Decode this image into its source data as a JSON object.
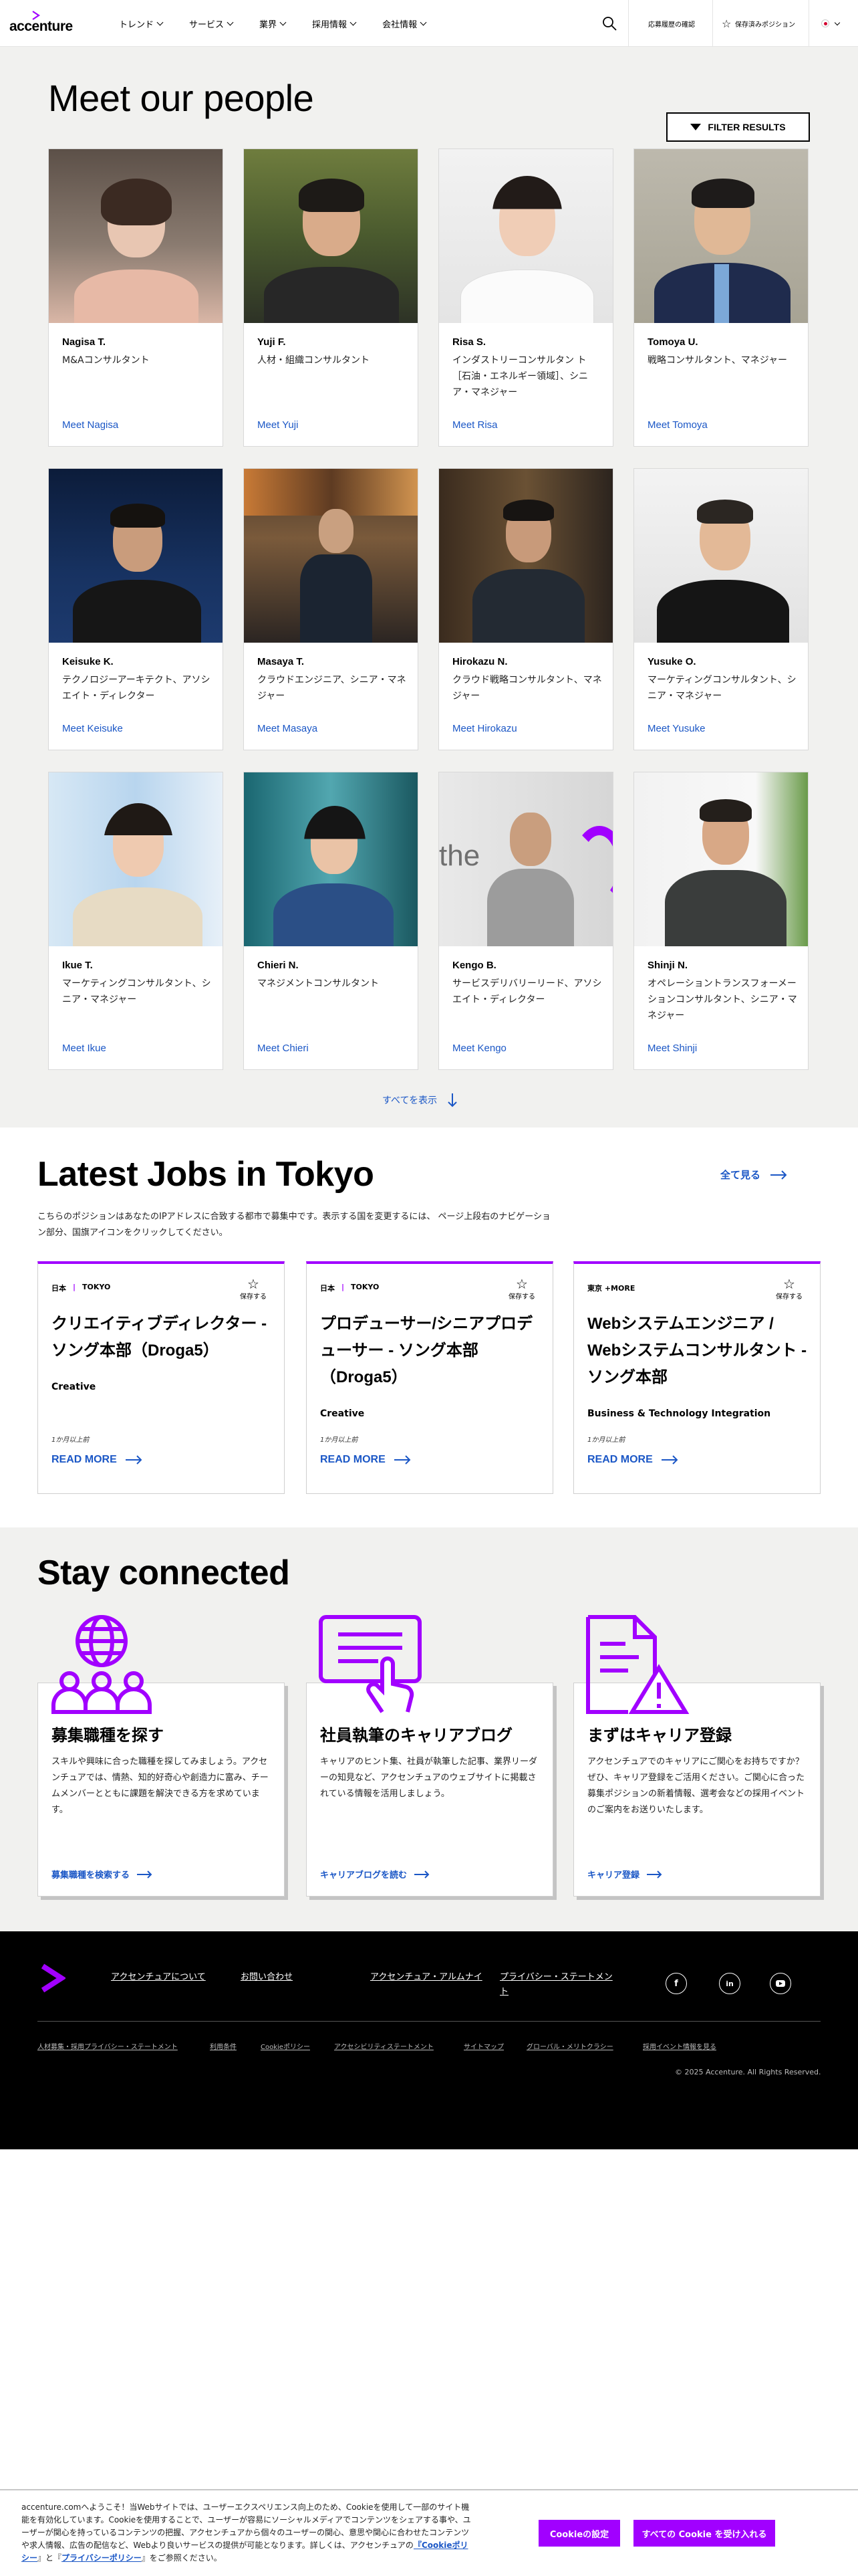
{
  "header": {
    "logo_text": "accenture",
    "nav": [
      {
        "label": "トレンド"
      },
      {
        "label": "サービス"
      },
      {
        "label": "業界"
      },
      {
        "label": "採用情報"
      },
      {
        "label": "会社情報"
      }
    ],
    "history_link": "応募履歴の確認",
    "saved_link": "保存済みポジション"
  },
  "people": {
    "title": "Meet our people",
    "filter_label": "FILTER RESULTS",
    "cards": [
      {
        "name": "Nagisa T.",
        "role": "M&Aコンサルタント",
        "link": "Meet Nagisa"
      },
      {
        "name": "Yuji F.",
        "role": "人材・組織コンサルタント",
        "link": "Meet Yuji"
      },
      {
        "name": "Risa S.",
        "role": "インダストリーコンサルタン ト［石油・エネルギー領域］、シニア・マネジャー",
        "link": "Meet Risa"
      },
      {
        "name": "Tomoya U.",
        "role": "戦略コンサルタント、マネジャー",
        "link": "Meet Tomoya"
      },
      {
        "name": "Keisuke K.",
        "role": "テクノロジーアーキテクト、アソシエイト・ディレクター",
        "link": "Meet Keisuke"
      },
      {
        "name": "Masaya T.",
        "role": "クラウドエンジニア、シニア・マネジャー",
        "link": "Meet Masaya"
      },
      {
        "name": "Hirokazu N.",
        "role": "クラウド戦略コンサルタント、マネジャー",
        "link": "Meet Hirokazu"
      },
      {
        "name": "Yusuke O.",
        "role": "マーケティングコンサルタント、シニア・マネジャー",
        "link": "Meet Yusuke"
      },
      {
        "name": "Ikue T.",
        "role": "マーケティングコンサルタント、シニア・マネジャー",
        "link": "Meet Ikue"
      },
      {
        "name": "Chieri N.",
        "role": "マネジメントコンサルタント",
        "link": "Meet Chieri"
      },
      {
        "name": "Kengo B.",
        "role": "サービスデリバリーリード、アソシエイト・ディレクター",
        "link": "Meet Kengo"
      },
      {
        "name": "Shinji N.",
        "role": "オペレーショントランスフォーメーションコンサルタント、シニア・マネジャー",
        "link": "Meet Shinji"
      }
    ],
    "show_all": "すべてを表示"
  },
  "jobs": {
    "title": "Latest Jobs in Tokyo",
    "see_all": "全て見る",
    "note": "こちらのポジションはあなたのIPアドレスに合致する都市で募集中です。表示する国を変更するには、 ページ上段右のナビゲーション部分、国旗アイコンをクリックしてください。",
    "save_label": "保存する",
    "more_label": "READ MORE",
    "cards": [
      {
        "country": "日本",
        "city": "TOKYO",
        "title": "クリエイティブディレクター - ソング本部（Droga5）",
        "category": "Creative",
        "posted": "1か月以上前"
      },
      {
        "country": "日本",
        "city": "TOKYO",
        "title": "プロデューサー/シニアプロデューサー - ソング本部（Droga5）",
        "category": "Creative",
        "posted": "1か月以上前"
      },
      {
        "country": "東京 +MORE",
        "city": "",
        "title": "Webシステムエンジニア / Webシステムコンサルタント - ソング本部",
        "category": "Business & Technology Integration",
        "posted": "1か月以上前"
      }
    ]
  },
  "stay": {
    "title": "Stay connected",
    "cards": [
      {
        "heading": "募集職種を探す",
        "body": "スキルや興味に合った職種を探してみましょう。アクセンチュアでは、情熱、知的好奇心や創造力に富み、チームメンバーとともに課題を解決できる方を求めています。",
        "link": "募集職種を検索する"
      },
      {
        "heading": "社員執筆のキャリアブログ",
        "body": "キャリアのヒント集、社員が執筆した記事、業界リーダーの知見など、アクセンチュアのウェブサイトに掲載されている情報を活用しましょう。",
        "link": "キャリアブログを読む"
      },
      {
        "heading": "まずはキャリア登録",
        "body": "アクセンチュアでのキャリアにご関心をお持ちですか？ぜひ、キャリア登録をご活用ください。ご関心に合った募集ポジションの新着情報、選考会などの採用イベントのご案内をお送りいたします。",
        "link": "キャリア登録"
      }
    ]
  },
  "footer": {
    "links": [
      "アクセンチュアについて",
      "お問い合わせ",
      "アクセンチュア・アルムナイ",
      "プライバシー・ステートメント"
    ],
    "social": [
      "f",
      "in",
      "yt"
    ],
    "small_links": [
      "人材募集・採用プライバシー・ステートメント",
      "利用条件",
      "Cookieポリシー",
      "アクセシビリティステートメント",
      "サイトマップ",
      "グローバル・メリトクラシー",
      "採用イベント情報を見る"
    ],
    "copyright": "© 2025 Accenture. All Rights Reserved."
  },
  "cookie": {
    "text": "accenture.comへようこそ！当Webサイトでは、ユーザーエクスペリエンス向上のため、Cookieを使用して一部のサイト機能を有効化しています。Cookieを使用することで、ユーザーが容易にソーシャルメディアでコンテンツをシェアする事や、ユーザーが関心を持っているコンテンツの把握、アクセンチュアから個々のユーザーの関心、意思や関心に合わせたコンテンツや求人情報、広告の配信など、Webより良いサービスの提供が可能となります。詳しくは、アクセンチュアの",
    "cookie_policy": "『Cookieポリシー",
    "and": "』と『",
    "privacy_policy": "プライバシーポリシー",
    "end": "』をご参照ください。",
    "settings_btn": "Cookieの設定",
    "accept_btn": "すべての Cookie を受け入れる"
  },
  "colors": {
    "accent": "#a100ff",
    "link": "#1b57c6",
    "section_bg": "#f1f1ef"
  }
}
